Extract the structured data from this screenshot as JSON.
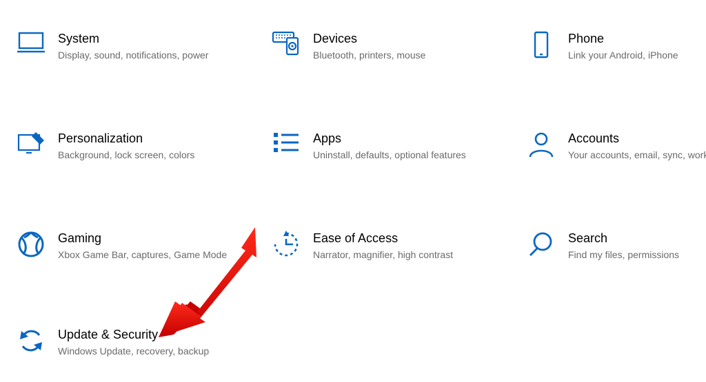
{
  "accent": "#0a66c2",
  "tiles": [
    {
      "id": "system",
      "title": "System",
      "desc": "Display, sound, notifications, power"
    },
    {
      "id": "devices",
      "title": "Devices",
      "desc": "Bluetooth, printers, mouse"
    },
    {
      "id": "phone",
      "title": "Phone",
      "desc": "Link your Android, iPhone"
    },
    {
      "id": "personalization",
      "title": "Personalization",
      "desc": "Background, lock screen, colors"
    },
    {
      "id": "apps",
      "title": "Apps",
      "desc": "Uninstall, defaults, optional features"
    },
    {
      "id": "accounts",
      "title": "Accounts",
      "desc": "Your accounts, email, sync, work, family"
    },
    {
      "id": "gaming",
      "title": "Gaming",
      "desc": "Xbox Game Bar, captures, Game Mode"
    },
    {
      "id": "ease",
      "title": "Ease of Access",
      "desc": "Narrator, magnifier, high contrast"
    },
    {
      "id": "search",
      "title": "Search",
      "desc": "Find my files, permissions"
    },
    {
      "id": "update",
      "title": "Update & Security",
      "desc": "Windows Update, recovery, backup"
    }
  ]
}
